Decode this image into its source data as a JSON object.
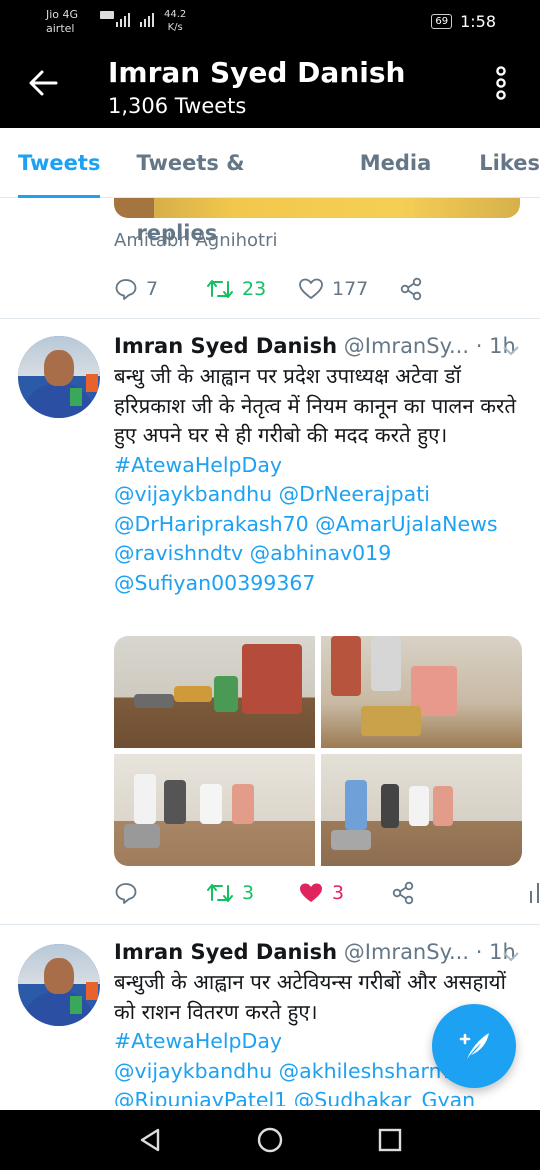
{
  "status_bar": {
    "carrier1": "Jio 4G",
    "carrier2": "airtel",
    "signal_labels": "4G",
    "speed_value": "44.2",
    "speed_unit": "K/s",
    "battery": "69",
    "time": "1:58"
  },
  "header": {
    "name": "Imran Syed Danish",
    "tweet_count": "1,306 Tweets"
  },
  "tabs": [
    {
      "label": "Tweets",
      "active": true
    },
    {
      "label": "Tweets & replies",
      "active": false
    },
    {
      "label": "Media",
      "active": false
    },
    {
      "label": "Likes",
      "active": false
    }
  ],
  "prev_tweet": {
    "credit": "Amitabh Agnihotri",
    "replies": "7",
    "retweets": "23",
    "likes": "177"
  },
  "tweet1": {
    "name": "Imran Syed Danish",
    "handle": "@ImranSy...",
    "time": "· 1h",
    "text": "बन्धु जी के आह्वान पर प्रदेश उपाध्यक्ष अटेवा डॉ हरिप्रकाश जी के नेतृत्व में नियम कानून का पालन करते हुए अपने घर से ही गरीबो की मदद करते हुए।",
    "links": [
      "#AtewaHelpDay",
      "@vijaykbandhu @DrNeerajpati",
      "@DrHariprakash70 @AmarUjalaNews",
      "@ravishndtv @abhinav019",
      "@Sufiyan00399367"
    ],
    "replies": "",
    "retweets": "3",
    "likes": "3"
  },
  "tweet2": {
    "name": "Imran Syed Danish",
    "handle": "@ImranSy...",
    "time": "· 1h",
    "text": "बन्धुजी के आह्वान पर अटेवियन्स गरीबों और असहायों को राशन वितरण करते हुए।",
    "links": [
      "#AtewaHelpDay",
      "@vijaykbandhu @akhileshsharm",
      "@RipunjayPatel1 @Sudhakar_Gyan"
    ]
  },
  "colors": {
    "accent": "#1da1f2",
    "retweet": "#17bf63",
    "like": "#e0245e",
    "muted": "#657786"
  },
  "icons": {
    "back": "back-arrow-icon",
    "more": "more-vertical-icon",
    "reply": "reply-icon",
    "retweet": "retweet-icon",
    "like": "heart-icon",
    "share": "share-icon",
    "analytics": "analytics-icon",
    "compose": "compose-tweet-icon"
  }
}
